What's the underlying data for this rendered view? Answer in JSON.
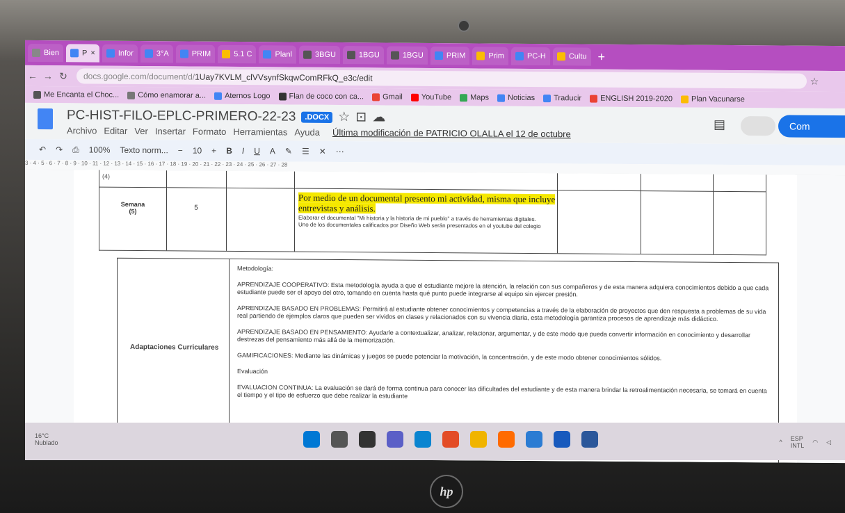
{
  "tabs": [
    {
      "label": "Bien",
      "active": false,
      "color": "#888"
    },
    {
      "label": "P",
      "active": true,
      "color": "#4285f4"
    },
    {
      "label": "Infor",
      "active": false,
      "color": "#4285f4"
    },
    {
      "label": "3°A",
      "active": false,
      "color": "#4285f4"
    },
    {
      "label": "PRIM",
      "active": false,
      "color": "#4285f4"
    },
    {
      "label": "5.1 C",
      "active": false,
      "color": "#fbbc04"
    },
    {
      "label": "Planl",
      "active": false,
      "color": "#4285f4"
    },
    {
      "label": "3BGU",
      "active": false,
      "color": "#555"
    },
    {
      "label": "1BGU",
      "active": false,
      "color": "#555"
    },
    {
      "label": "1BGU",
      "active": false,
      "color": "#555"
    },
    {
      "label": "PRIM",
      "active": false,
      "color": "#4285f4"
    },
    {
      "label": "Prim",
      "active": false,
      "color": "#fbbc04"
    },
    {
      "label": "PC-H",
      "active": false,
      "color": "#4285f4"
    },
    {
      "label": "Cultu",
      "active": false,
      "color": "#fbbc04"
    }
  ],
  "url": {
    "dim": "docs.google.com/document/d/",
    "main": "1Uay7KVLM_clVVsynfSkqwComRFkQ_e3c/edit"
  },
  "bookmarks": [
    {
      "label": "Me Encanta el Choc...",
      "color": "#555"
    },
    {
      "label": "Cómo enamorar a...",
      "color": "#777"
    },
    {
      "label": "Aternos Logo",
      "color": "#4285f4"
    },
    {
      "label": "Flan de coco con ca...",
      "color": "#333"
    },
    {
      "label": "Gmail",
      "color": "#ea4335"
    },
    {
      "label": "YouTube",
      "color": "#ff0000"
    },
    {
      "label": "Maps",
      "color": "#34a853"
    },
    {
      "label": "Noticias",
      "color": "#4285f4"
    },
    {
      "label": "Traducir",
      "color": "#4285f4"
    },
    {
      "label": "ENGLISH 2019-2020",
      "color": "#ea4335"
    },
    {
      "label": "Plan Vacunarse",
      "color": "#fbbc04"
    }
  ],
  "doc": {
    "title": "PC-HIST-FILO-EPLC-PRIMERO-22-23",
    "badge": ".DOCX",
    "menu": [
      "Archivo",
      "Editar",
      "Ver",
      "Insertar",
      "Formato",
      "Herramientas",
      "Ayuda"
    ],
    "last_modified": "Última modificación de PATRICIO OLALLA el 12 de octubre",
    "share_label": "Com"
  },
  "toolbar": {
    "zoom": "100%",
    "style": "Texto norm...",
    "font_size": "10"
  },
  "ruler": "3 · 4 · 5 · 6 · 7 · 8 · 9 · 10 · 11 · 12 · 13 · 14 · 15 · 16 · 17 · 18 · 19 · 20 · 21 · 22 · 23 · 24 · 25 · 26 · 27 · 28",
  "table1": {
    "week_label": "Semana",
    "week_num": "(5)",
    "week_num_top": "(4)",
    "count": "5",
    "highlight": "Por medio de un documental presento mi actividad, misma que incluye entrevistas y análisis.",
    "lines": [
      "Elaborar el documental \"Mi historia y la historia de mi pueblo\" a través de herramientas digitales.",
      "Uno de los documentales calificados por Diseño Web serán presentados en el youtube del colegio"
    ]
  },
  "table2": {
    "label": "Adaptaciones Curriculares",
    "heading": "Metodología:",
    "paragraphs": [
      "APRENDIZAJE COOPERATIVO: Esta metodología ayuda a que el estudiante mejore la atención, la relación con sus compañeros y de esta manera adquiera conocimientos debido a que cada estudiante puede ser el apoyo del otro, tomando en cuenta hasta qué punto puede integrarse al equipo sin ejercer presión.",
      "APRENDIZAJE BASADO EN PROBLEMAS: Permitirá al estudiante obtener conocimientos y competencias a través de la elaboración de proyectos que den respuesta a problemas de su vida real partiendo de ejemplos claros que pueden ser vividos en clases y relacionados con su vivencia diaria, esta metodología garantiza procesos de aprendizaje más didáctico.",
      "APRENDIZAJE BASADO EN PENSAMIENTO: Ayudarle a contextualizar, analizar, relacionar, argumentar, y de este modo que pueda convertir información en conocimiento y desarrollar destrezas del pensamiento más allá de la memorización.",
      "GAMIFICACIONES: Mediante las dinámicas y juegos se puede potenciar la motivación, la concentración, y de este modo obtener conocimientos sólidos.",
      "Evaluación",
      "EVALUACION CONTINUA: La evaluación se dará de forma continua para conocer las dificultades del estudiante y de esta manera brindar la retroalimentación necesaria, se tomará en cuenta el tiempo y el tipo de esfuerzo que debe realizar la estudiante"
    ]
  },
  "taskbar": {
    "temp": "16°C",
    "weather": "Nublado",
    "lang1": "ESP",
    "lang2": "INTL"
  },
  "apps_colors": [
    "#0078d4",
    "#555",
    "#333",
    "#5b5fc7",
    "#0a84d0",
    "#e34c26",
    "#f0b400",
    "#ff6b00",
    "#2b7cd3",
    "#185abd",
    "#2b579a"
  ]
}
